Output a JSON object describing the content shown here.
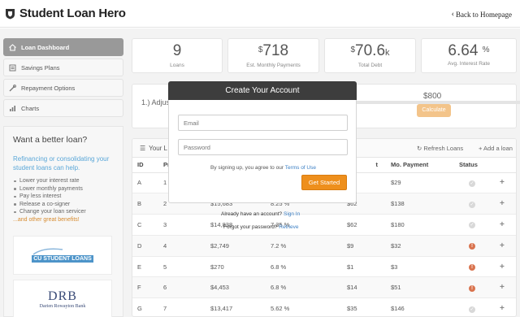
{
  "header": {
    "app_title": "Student Loan Hero",
    "back_link": "Back to Homepage"
  },
  "sidebar": {
    "items": [
      {
        "label": "Loan Dashboard",
        "icon": "home-icon"
      },
      {
        "label": "Savings Plans",
        "icon": "document-icon"
      },
      {
        "label": "Repayment Options",
        "icon": "tools-icon"
      },
      {
        "label": "Charts",
        "icon": "bar-chart-icon"
      }
    ],
    "promo": {
      "title": "Want a better loan?",
      "lead": "Refinancing or consolidating your student loans can help.",
      "bullets": [
        "Lower your interest rate",
        "Lower monthly payments",
        "Pay less interest",
        "Release a co-signer",
        "Change your loan servicer"
      ],
      "more": "...and other great benefits!",
      "lenders": [
        {
          "logo_text": "CU STUDENT LOANS"
        },
        {
          "logo_text": "DRB",
          "sub": "Darien Rowayton Bank"
        }
      ]
    }
  },
  "stats": [
    {
      "prefix": "",
      "value": "9",
      "suffix": "",
      "label": "Loans"
    },
    {
      "prefix": "$",
      "value": "718",
      "suffix": "",
      "label": "Est. Monthly Payments"
    },
    {
      "prefix": "$",
      "value": "70.6",
      "suffix": "k",
      "label": "Total Debt"
    },
    {
      "prefix": "",
      "value": "6.64",
      "suffix": "%",
      "label": "Avg. Interest Rate"
    }
  ],
  "adjust": {
    "title": "1.) Adjust your Monthly Payment",
    "amount": "$800",
    "calculate_label": "Calculate"
  },
  "loans_table": {
    "title": "Your L",
    "refresh_label": "Refresh Loans",
    "add_label": "+ Add a loan",
    "columns": [
      "ID",
      "Pr",
      "",
      "",
      "t",
      "Mo. Payment",
      "Status",
      ""
    ],
    "rows": [
      {
        "id": "A",
        "pr": "1",
        "bal": "",
        "rate": "",
        "min": "",
        "payment": "$29",
        "status": "ok"
      },
      {
        "id": "B",
        "pr": "2",
        "bal": "$15,683",
        "rate": "8.25 %",
        "min": "$62",
        "payment": "$138",
        "status": "ok"
      },
      {
        "id": "C",
        "pr": "3",
        "bal": "$14,838",
        "rate": "7.35 %",
        "min": "$62",
        "payment": "$180",
        "status": "ok"
      },
      {
        "id": "D",
        "pr": "4",
        "bal": "$2,749",
        "rate": "7.2 %",
        "min": "$9",
        "payment": "$32",
        "status": "warn"
      },
      {
        "id": "E",
        "pr": "5",
        "bal": "$270",
        "rate": "6.8 %",
        "min": "$1",
        "payment": "$3",
        "status": "warn"
      },
      {
        "id": "F",
        "pr": "6",
        "bal": "$4,453",
        "rate": "6.8 %",
        "min": "$14",
        "payment": "$51",
        "status": "warn"
      },
      {
        "id": "G",
        "pr": "7",
        "bal": "$13,417",
        "rate": "5.62 %",
        "min": "$35",
        "payment": "$146",
        "status": "ok"
      }
    ]
  },
  "modal": {
    "title": "Create Your Account",
    "email_placeholder": "Email",
    "password_placeholder": "Password",
    "terms_prefix": "By signing up, you agree to our",
    "terms_link": "Terms of Use",
    "submit_label": "Get Started",
    "have_account": "Already have an account?",
    "signin_link": "Sign In",
    "forgot": "Forgot your password?",
    "retrieve_link": "Retrieve"
  },
  "colors": {
    "accent_orange": "#ee8f1c",
    "link_blue": "#3b7fc4",
    "modal_header": "#3d3d3d",
    "warning_status": "#d9734e"
  }
}
